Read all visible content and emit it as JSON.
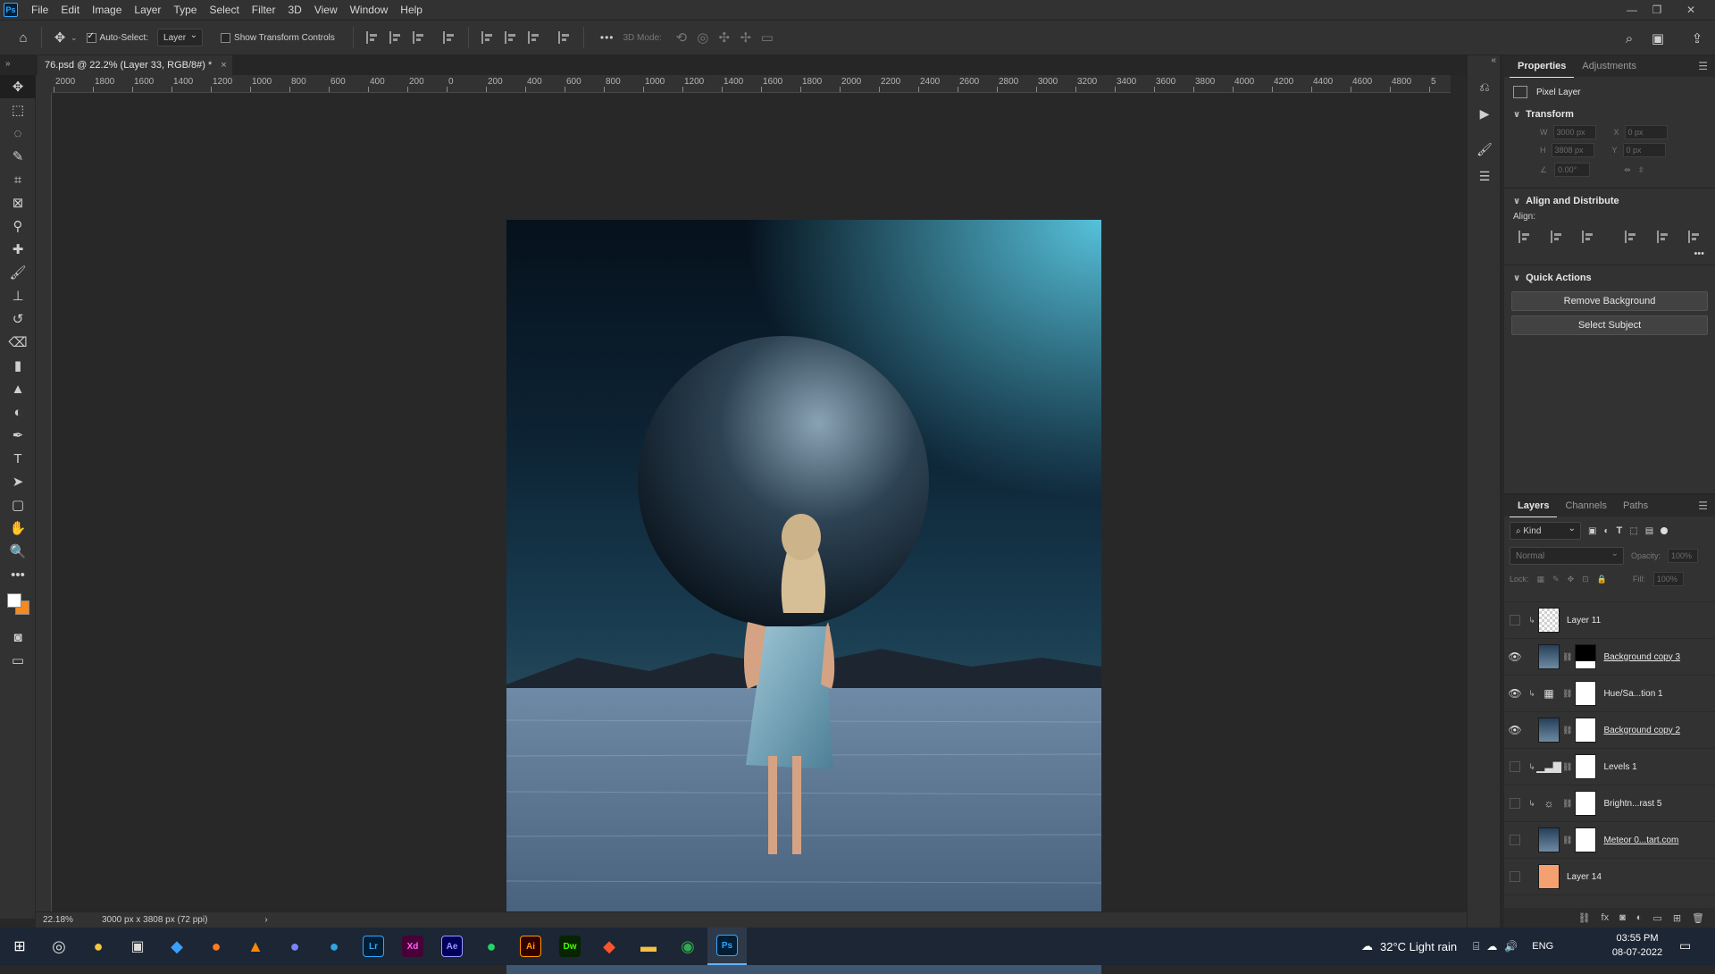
{
  "app": {
    "logo": "Ps",
    "menu": [
      "File",
      "Edit",
      "Image",
      "Layer",
      "Type",
      "Select",
      "Filter",
      "3D",
      "View",
      "Window",
      "Help"
    ]
  },
  "options": {
    "auto_select_label": "Auto-Select:",
    "auto_select_value": "Layer",
    "show_transform_label": "Show Transform Controls",
    "mode_3d_label": "3D Mode:",
    "more": "•••"
  },
  "document": {
    "tab_title": "76.psd @ 22.2% (Layer 33, RGB/8#) *",
    "close": "×"
  },
  "ruler": {
    "h_labels": [
      "2000",
      "1800",
      "1600",
      "1400",
      "1200",
      "1000",
      "800",
      "600",
      "400",
      "200",
      "0",
      "200",
      "400",
      "600",
      "800",
      "1000",
      "1200",
      "1400",
      "1600",
      "1800",
      "2000",
      "2200",
      "2400",
      "2600",
      "2800",
      "3000",
      "3200",
      "3400",
      "3600",
      "3800",
      "4000",
      "4200",
      "4400",
      "4600",
      "4800",
      "5"
    ]
  },
  "status": {
    "zoom": "22.18%",
    "doc_info": "3000 px x 3808 px (72 ppi)",
    "arrow": "›"
  },
  "properties": {
    "tabs": [
      "Properties",
      "Adjustments"
    ],
    "layer_type": "Pixel Layer",
    "transform_title": "Transform",
    "w_label": "W",
    "w_value": "3000 px",
    "h_label": "H",
    "h_value": "3808 px",
    "x_label": "X",
    "x_value": "0 px",
    "y_label": "Y",
    "y_value": "0 px",
    "angle_value": "0.00°",
    "align_title": "Align and Distribute",
    "align_label": "Align:",
    "quick_actions_title": "Quick Actions",
    "remove_bg": "Remove Background",
    "select_subject": "Select Subject",
    "more": "•••"
  },
  "layers_panel": {
    "tabs": [
      "Layers",
      "Channels",
      "Paths"
    ],
    "filter_kind": "Kind",
    "blend_mode": "Normal",
    "opacity_label": "Opacity:",
    "opacity_value": "100%",
    "lock_label": "Lock:",
    "fill_label": "Fill:",
    "fill_value": "100%",
    "layers": [
      {
        "name": "Layer 11",
        "visible": false,
        "kind": "pixel"
      },
      {
        "name": "Background copy 3",
        "visible": true,
        "kind": "smart-mask-black"
      },
      {
        "name": "Hue/Sa...tion 1",
        "visible": true,
        "kind": "adjust-hue"
      },
      {
        "name": "Background copy 2",
        "visible": true,
        "kind": "smart-mask"
      },
      {
        "name": "Levels 1",
        "visible": false,
        "kind": "adjust-levels"
      },
      {
        "name": "Brightn...rast 5",
        "visible": false,
        "kind": "adjust-brightness"
      },
      {
        "name": "Meteor 0...tart.com",
        "visible": false,
        "kind": "smart-mask"
      },
      {
        "name": "Layer 14",
        "visible": false,
        "kind": "pixel-orange"
      }
    ]
  },
  "taskbar": {
    "weather": "32°C  Light rain",
    "lang": "ENG",
    "time": "03:55 PM",
    "date": "08-07-2022",
    "apps": [
      {
        "label": "Lr",
        "color": "#31a8ff",
        "bg": "#001e36"
      },
      {
        "label": "Xd",
        "color": "#ff61f6",
        "bg": "#470137"
      },
      {
        "label": "Ae",
        "color": "#9999ff",
        "bg": "#00005b"
      },
      {
        "label": "Ai",
        "color": "#ff9a00",
        "bg": "#330000"
      },
      {
        "label": "Dw",
        "color": "#4aff00",
        "bg": "#072401"
      },
      {
        "label": "Ps",
        "color": "#31a8ff",
        "bg": "#001e36"
      }
    ]
  }
}
